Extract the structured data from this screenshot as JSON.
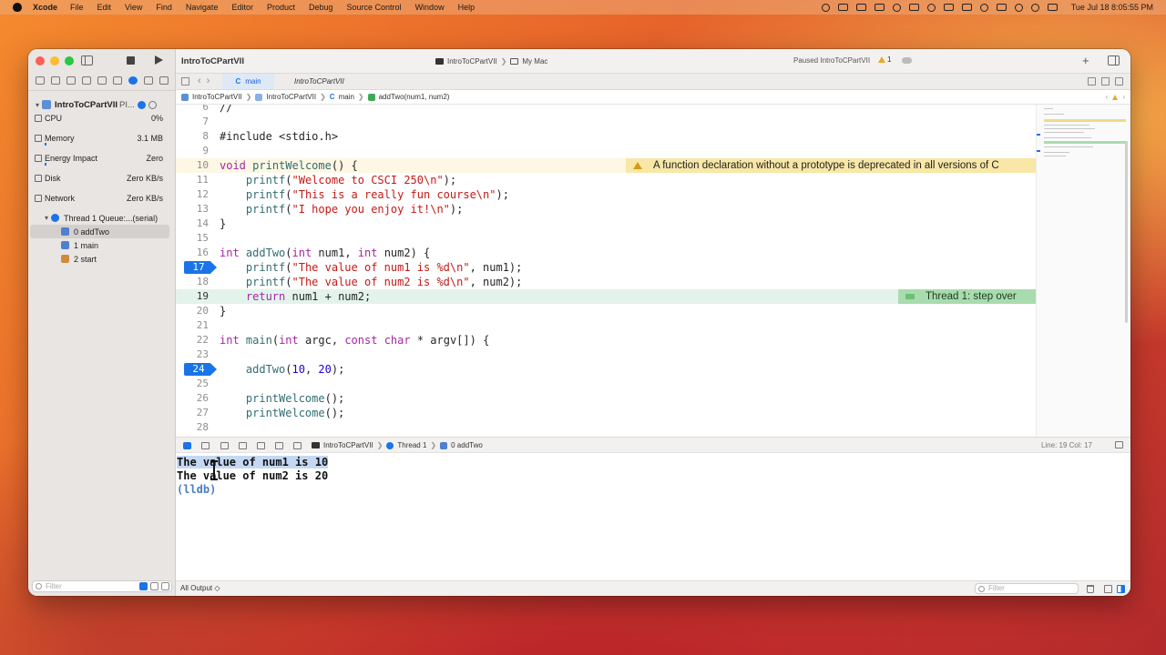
{
  "menubar": {
    "app": "Xcode",
    "items": [
      "File",
      "Edit",
      "View",
      "Find",
      "Navigate",
      "Editor",
      "Product",
      "Debug",
      "Source Control",
      "Window",
      "Help"
    ],
    "clock": "Tue Jul 18  8:05:55 PM"
  },
  "window": {
    "project_title": "IntroToCPartVII",
    "scheme": "IntroToCPartVII",
    "destination": "My Mac",
    "status": "Paused IntroToCPartVII",
    "warning_count": "1"
  },
  "navigator": {
    "process_name": "IntroToCPartVII",
    "process_suffix": "PI...",
    "gauges": [
      {
        "label": "CPU",
        "value": "0%",
        "icon": "cpu-icon",
        "level": 0
      },
      {
        "label": "Memory",
        "value": "3.1 MB",
        "icon": "memory-icon",
        "level": 0.01
      },
      {
        "label": "Energy Impact",
        "value": "Zero",
        "icon": "energy-icon",
        "level": 0
      },
      {
        "label": "Disk",
        "value": "Zero KB/s",
        "icon": "disk-icon",
        "level": 0
      },
      {
        "label": "Network",
        "value": "Zero KB/s",
        "icon": "network-icon",
        "level": 0
      }
    ],
    "thread": "Thread 1 Queue:...(serial)",
    "frames": [
      "0 addTwo",
      "1 main",
      "2 start"
    ],
    "filter_placeholder": "Filter"
  },
  "tabs": {
    "active": "main",
    "inactive": "IntroToCPartVII"
  },
  "jumpbar": {
    "project": "IntroToCPartVII",
    "group": "IntroToCPartVII",
    "file": "main",
    "func": "addTwo(num1, num2)"
  },
  "code": {
    "lines": [
      {
        "n": "6",
        "text": "//"
      },
      {
        "n": "7",
        "text": ""
      },
      {
        "n": "8",
        "text": "#include <stdio.h>"
      },
      {
        "n": "9",
        "text": ""
      },
      {
        "n": "10",
        "text": "void printWelcome() {"
      },
      {
        "n": "11",
        "text": "    printf(\"Welcome to CSCI 250\\n\");"
      },
      {
        "n": "12",
        "text": "    printf(\"This is a really fun course\\n\");"
      },
      {
        "n": "13",
        "text": "    printf(\"I hope you enjoy it!\\n\");"
      },
      {
        "n": "14",
        "text": "}"
      },
      {
        "n": "15",
        "text": ""
      },
      {
        "n": "16",
        "text": "int addTwo(int num1, int num2) {"
      },
      {
        "n": "17",
        "text": "    printf(\"The value of num1 is %d\\n\", num1);"
      },
      {
        "n": "18",
        "text": "    printf(\"The value of num2 is %d\\n\", num2);"
      },
      {
        "n": "19",
        "text": "    return num1 + num2;"
      },
      {
        "n": "20",
        "text": "}"
      },
      {
        "n": "21",
        "text": ""
      },
      {
        "n": "22",
        "text": "int main(int argc, const char * argv[]) {"
      },
      {
        "n": "23",
        "text": ""
      },
      {
        "n": "24",
        "text": "    addTwo(10, 20);"
      },
      {
        "n": "25",
        "text": ""
      },
      {
        "n": "26",
        "text": "    printWelcome();"
      },
      {
        "n": "27",
        "text": "    printWelcome();"
      },
      {
        "n": "28",
        "text": ""
      }
    ],
    "warning_message": "A function declaration without a prototype is deprecated in all versions of C",
    "step_message": "Thread 1: step over"
  },
  "debugbar": {
    "crumbs": [
      "IntroToCPartVII",
      "Thread 1",
      "0 addTwo"
    ],
    "line_col": "Line: 19  Col: 17"
  },
  "console": {
    "lines": [
      "The value of num1 is 10",
      "The value of num2 is 20"
    ],
    "prompt": "(lldb)",
    "output_select": "All Output ◇",
    "filter_placeholder": "Filter"
  }
}
